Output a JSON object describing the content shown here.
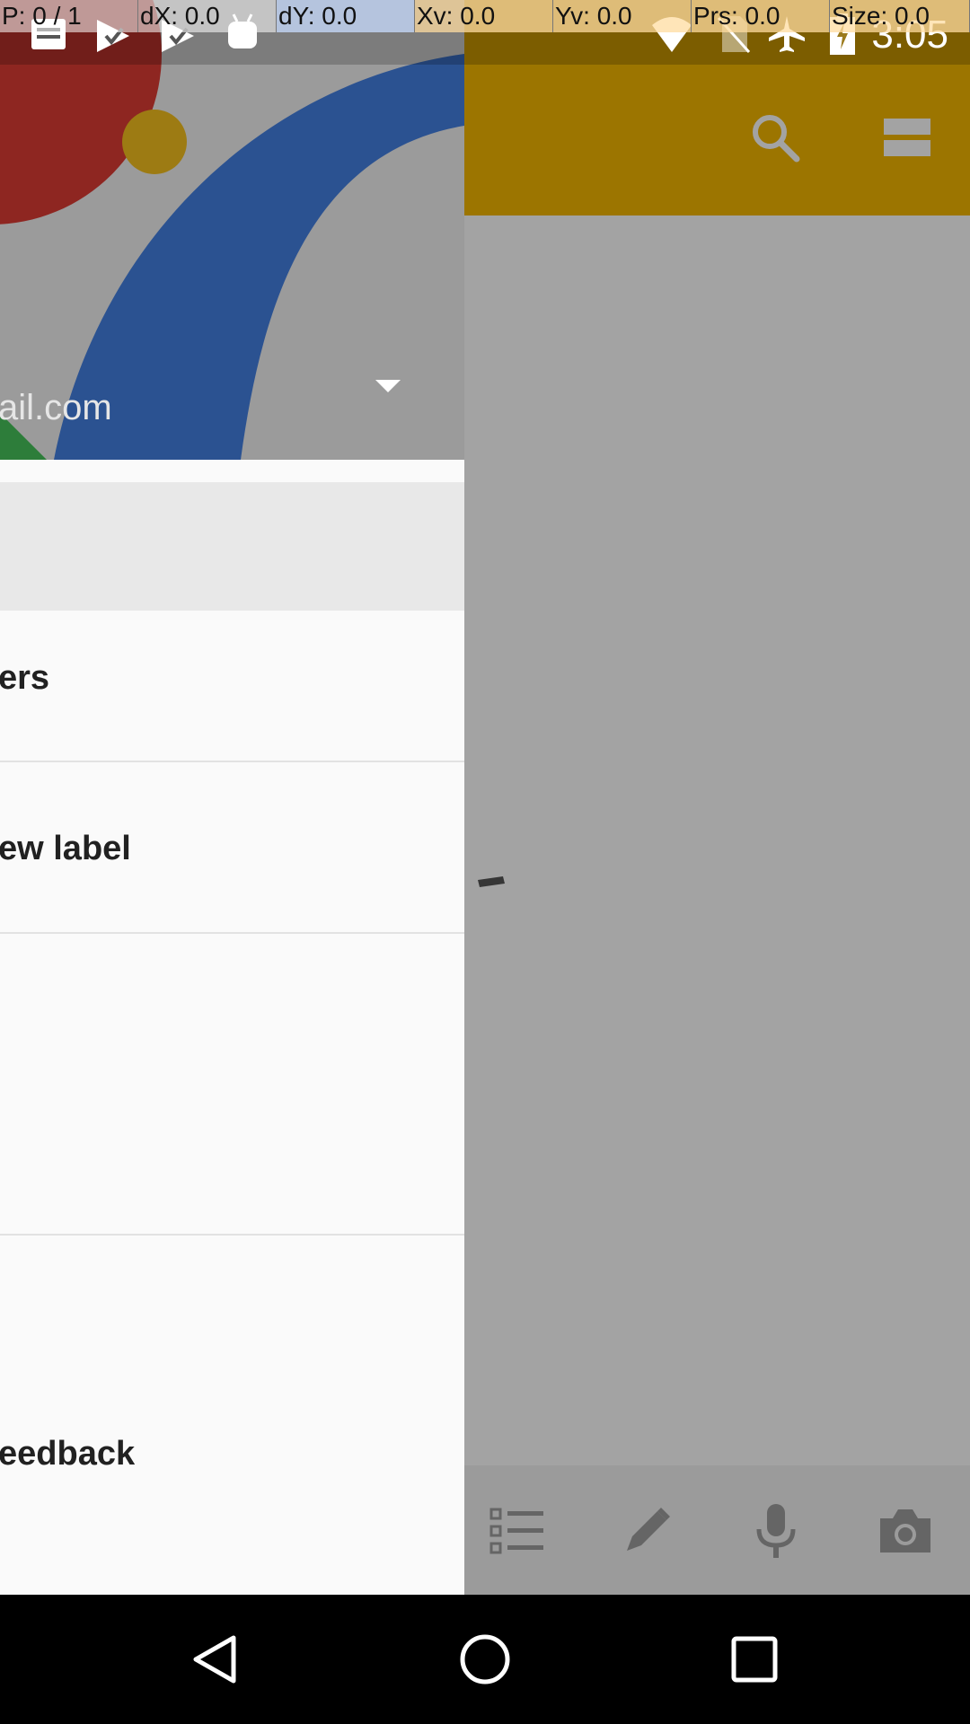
{
  "debug_overlay": {
    "pointer": "P: 0 / 1",
    "dx": "dX: 0.0",
    "dy": "dY: 0.0",
    "xv": "Xv: 0.0",
    "yv": "Yv: 0.0",
    "prs": "Prs: 0.0",
    "size": "Size: 0.0"
  },
  "status_bar": {
    "time": "3:05",
    "notification_icons": [
      "keep-notes-icon",
      "check-play-icon",
      "play-icon",
      "android-icon"
    ],
    "system_icons": [
      "wifi-icon",
      "no-sim-icon",
      "airplane-mode-icon",
      "battery-charging-icon"
    ]
  },
  "toolbar": {
    "icons": [
      "search-icon",
      "view-toggle-icon"
    ],
    "color": "#f5b800"
  },
  "drawer": {
    "account_email_fragment": "ail.com",
    "items": [
      {
        "label": ""
      },
      {
        "label": "ers"
      },
      {
        "label": "ew label"
      },
      {
        "label": ""
      },
      {
        "label": ":"
      },
      {
        "label": "eedback"
      }
    ]
  },
  "bottom_bar": {
    "icons": [
      "checklist-icon",
      "pen-icon",
      "mic-icon",
      "camera-icon"
    ]
  },
  "nav_bar": {
    "icons": [
      "back-icon",
      "home-icon",
      "recents-icon"
    ]
  }
}
